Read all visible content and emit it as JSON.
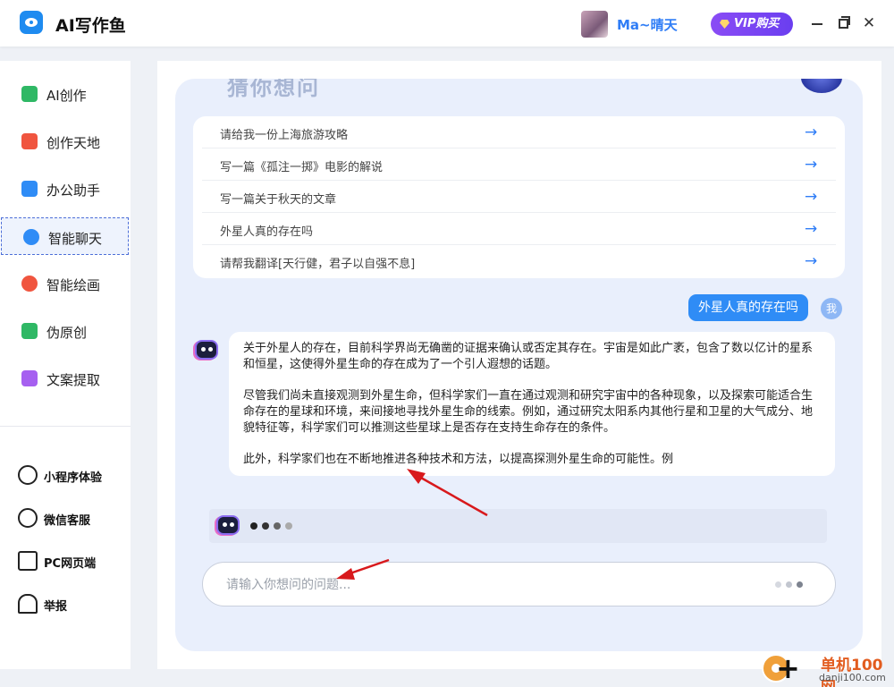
{
  "app": {
    "title": "AI写作鱼"
  },
  "user": {
    "name": "Ma~晴天",
    "vip_label": "VIP购买"
  },
  "window_controls": {
    "min": "minimize",
    "max": "maximize",
    "close": "✕"
  },
  "sidebar": {
    "items": [
      {
        "label": "AI创作",
        "icon": "ai-icon",
        "color": "#2fb865"
      },
      {
        "label": "创作天地",
        "icon": "pen-icon",
        "color": "#f0553f"
      },
      {
        "label": "办公助手",
        "icon": "briefcase-icon",
        "color": "#2f8cf6"
      },
      {
        "label": "智能聊天",
        "icon": "chat-bot-icon",
        "color": "#2f8cf6",
        "active": true
      },
      {
        "label": "智能绘画",
        "icon": "palette-icon",
        "color": "#f0553f"
      },
      {
        "label": "伪原创",
        "icon": "t-icon",
        "color": "#2fb865"
      },
      {
        "label": "文案提取",
        "icon": "folder-icon",
        "color": "#a660f0"
      }
    ],
    "bottom_items": [
      {
        "label": "小程序体验",
        "icon": "mini-program-icon"
      },
      {
        "label": "微信客服",
        "icon": "wechat-service-icon"
      },
      {
        "label": "PC网页端",
        "icon": "monitor-icon"
      },
      {
        "label": "举报",
        "icon": "alarm-icon"
      }
    ]
  },
  "chat": {
    "heading_partial": "猜你想问",
    "suggestions": [
      "请给我一份上海旅游攻略",
      "写一篇《孤注一掷》电影的解说",
      "写一篇关于秋天的文章",
      "外星人真的存在吗",
      "请帮我翻译[天行健，君子以自强不息]"
    ],
    "user_message": "外星人真的存在吗",
    "user_avatar_label": "我",
    "bot_paragraphs": [
      "关于外星人的存在，目前科学界尚无确凿的证据来确认或否定其存在。宇宙是如此广袤，包含了数以亿计的星系和恒星，这使得外星生命的存在成为了一个引人遐想的话题。",
      "尽管我们尚未直接观测到外星生命，但科学家们一直在通过观测和研究宇宙中的各种现象，以及探索可能适合生命存在的星球和环境，来间接地寻找外星生命的线索。例如，通过研究太阳系内其他行星和卫星的大气成分、地貌特征等，科学家们可以推测这些星球上是否存在支持生命存在的条件。",
      "此外，科学家们也在不断地推进各种技术和方法，以提高探测外星生命的可能性。例"
    ],
    "input_placeholder": "请输入你想问的问题..."
  },
  "colors": {
    "accent": "#2f7df6",
    "vip": "#7a44f2",
    "annotation": "#d8191c"
  },
  "watermark": {
    "line1": "单机100网",
    "line2": "danji100.com"
  }
}
